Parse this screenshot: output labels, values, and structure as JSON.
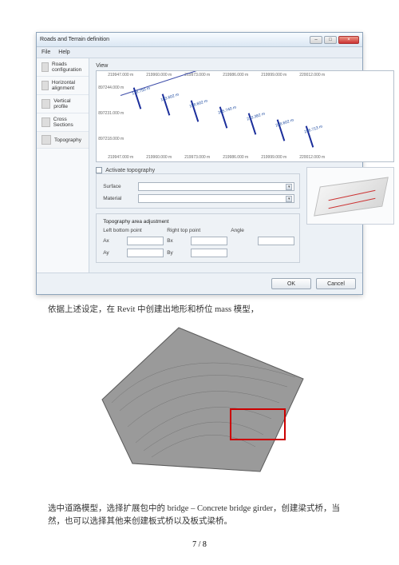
{
  "dialog": {
    "title": "Roads and Terrain definition",
    "menus": [
      "File",
      "Help"
    ],
    "nav": [
      {
        "label": "Roads configuration"
      },
      {
        "label": "Horizontal alignment"
      },
      {
        "label": "Vertical profile"
      },
      {
        "label": "Cross Sections"
      },
      {
        "label": "Topography"
      }
    ],
    "view_label": "View",
    "axis_top": [
      "219947.000 m",
      "219960.000 m",
      "219973.000 m",
      "219986.000 m",
      "219999.000 m",
      "220012.000 m"
    ],
    "axis_left": [
      "897244.000 m",
      "897231.000 m",
      "897218.000 m"
    ],
    "axis_bottom": [
      "219947.000 m",
      "219960.000 m",
      "219973.000 m",
      "219986.000 m",
      "219999.000 m",
      "220012.000 m"
    ],
    "stations": [
      "178.750 m",
      "183.602 m",
      "198.602 m",
      "205.740 m",
      "213.382 m",
      "228.602 m",
      "236.713 m"
    ],
    "activate": "Activate topography",
    "surface": "Surface",
    "material": "Material",
    "adj_title": "Topography area adjustment",
    "lb": "Left bottom point",
    "rt": "Right top point",
    "angle": "Angle",
    "Ax": "Ax",
    "Bx": "Bx",
    "Ay": "Ay",
    "By": "By",
    "ok": "OK",
    "cancel": "Cancel"
  },
  "caption1": "依据上述设定，在 Revit 中创建出地形和桥位 mass 模型，",
  "caption2": "选中道路模型，选择扩展包中的 bridge – Concrete bridge girder，创建梁式桥，当然，也可以选择其他来创建板式桥以及板式梁桥。",
  "pagenum": "7 / 8"
}
